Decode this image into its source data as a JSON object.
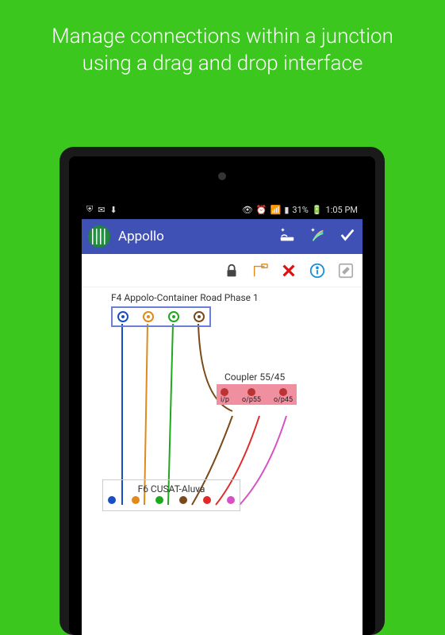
{
  "tagline": "Manage connections within a junction using a drag and drop interface",
  "statusbar": {
    "battery_pct": "31%",
    "time": "1:05 PM"
  },
  "appbar": {
    "title": "Appollo"
  },
  "canvas": {
    "top_label": "F4 Appolo-Container Road Phase 1",
    "mid_label": "Coupler 55/45",
    "mid_ports": [
      "i/p",
      "o/p55",
      "o/p45"
    ],
    "bot_label": "F6 CUSAT-Aluva",
    "colors": {
      "blue": "#1a4fc4",
      "orange": "#e08a1a",
      "green": "#1ea81e",
      "brown": "#7a4a1a",
      "red": "#e02a2a",
      "magenta": "#d94fc4"
    }
  }
}
